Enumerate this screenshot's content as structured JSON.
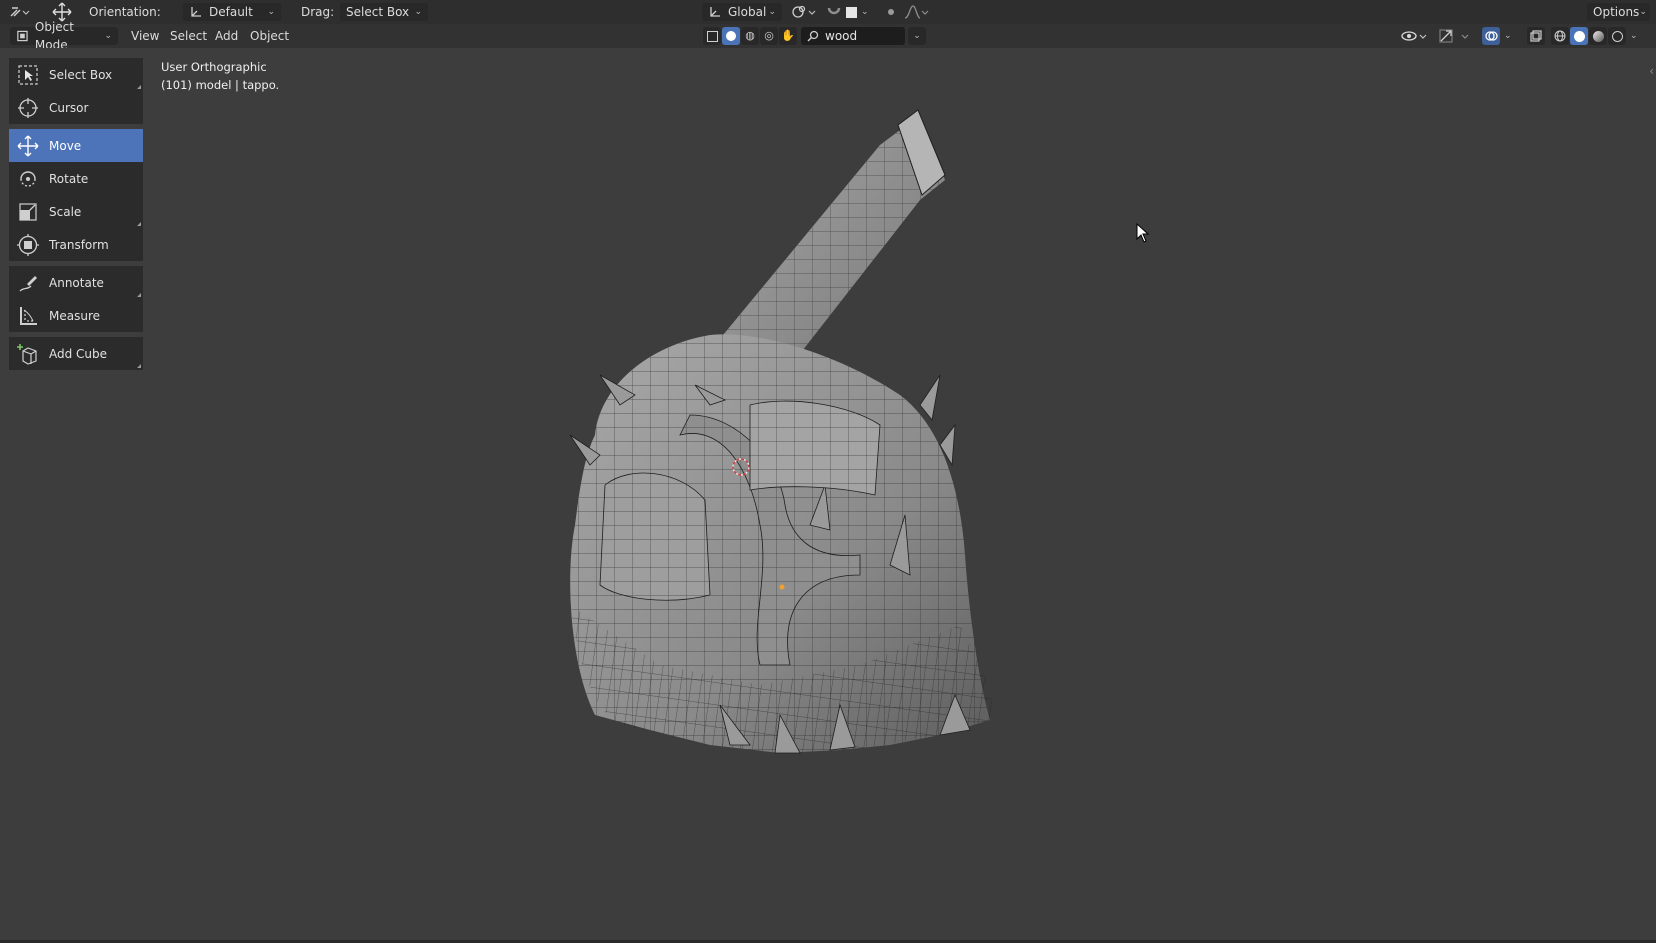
{
  "topbar": {
    "orientation_label": "Orientation:",
    "orientation_value": "Default",
    "drag_label": "Drag:",
    "drag_value": "Select Box",
    "transform_space": "Global",
    "options_label": "Options"
  },
  "header": {
    "mode": "Object Mode",
    "menus": [
      "View",
      "Select",
      "Add",
      "Object"
    ],
    "search_value": "wood"
  },
  "toolbar": {
    "tools": [
      {
        "label": "Select Box",
        "icon": "select-box-icon"
      },
      {
        "label": "Cursor",
        "icon": "cursor-icon"
      },
      {
        "label": "Move",
        "icon": "move-icon",
        "active": true
      },
      {
        "label": "Rotate",
        "icon": "rotate-icon"
      },
      {
        "label": "Scale",
        "icon": "scale-icon"
      },
      {
        "label": "Transform",
        "icon": "transform-icon"
      },
      {
        "label": "Annotate",
        "icon": "annotate-icon"
      },
      {
        "label": "Measure",
        "icon": "measure-icon"
      },
      {
        "label": "Add Cube",
        "icon": "add-cube-icon"
      }
    ]
  },
  "viewport": {
    "view_name": "User Orthographic",
    "object_info": "(101) model | tappo."
  },
  "colors": {
    "active_tool": "#4d74b8",
    "viewport_bg": "#3d3d3d",
    "header_bg": "#2e2e2e",
    "mesh_fill": "#8c8c8c",
    "wire": "#1c1c1c"
  }
}
